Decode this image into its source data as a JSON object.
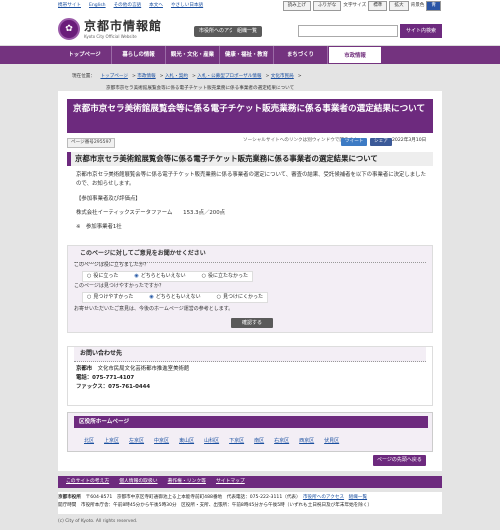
{
  "top": {
    "links": [
      "携帯サイト",
      "English",
      "その他の言語",
      "本文へ",
      "やさしい日本語"
    ],
    "read": "読み上げ",
    "ruby": "ふりがな",
    "size": "文字サイズ",
    "std": "標準",
    "big": "拡大",
    "color": "背景色",
    "blue": "青"
  },
  "site": {
    "name": "京都市情報館",
    "sub": "Kyoto City Official Website",
    "access": "市役所へのアクセス",
    "org": "組織一覧",
    "search_btn": "サイト内検索"
  },
  "nav": [
    "トップページ",
    "暮らしの情報",
    "観光・文化・産業",
    "健康・福祉・教育",
    "まちづくり",
    "市政情報"
  ],
  "crumb": {
    "label": "現在位置：",
    "items": [
      "トップページ",
      "市政情報",
      "入札・契約",
      "入札・公募型プロポーザル情報",
      "文化市民局"
    ],
    "last": "京都市京セラ美術館展覧会等に係る電子チケット販売業務に係る事業者の選定結果について"
  },
  "page": {
    "title": "京都市京セラ美術館展覧会等に係る電子チケット販売業務に係る事業者の選定結果について",
    "id": "ページ番号295597",
    "social": "ソーシャルサイトへのリンクは別ウィンドウで開きます",
    "tweet": "ツイート",
    "share": "シェア",
    "date": "2022年3月10日",
    "h2": "京都市京セラ美術館展覧会等に係る電子チケット販売業務に係る事業者の選定結果について",
    "p1": "京都市京セラ美術館展覧会等に係る電子チケット販売業務に係る事業者の選定について、審査の結果、受託候補者を以下の事業者に決定しましたので、お知らせします。",
    "eval": "【参加事業者及び評価点】",
    "company": "株式会社イーティックスデータファーム　　153.3点／200点",
    "note": "※　参加事業者1社"
  },
  "feedback": {
    "head": "このページに対してご意見をお聞かせください",
    "q1": "このページは役に立ちましたか？",
    "q1o": [
      "役に立った",
      "どちらともいえない",
      "役に立たなかった"
    ],
    "q2": "このページは見つけやすかったですか？",
    "q2o": [
      "見つけやすかった",
      "どちらともいえない",
      "見つけにくかった"
    ],
    "msg": "お寄せいただいたご意見は、今後のホームページ運営の参考とします。",
    "submit": "確認する"
  },
  "contact": {
    "head": "お問い合わせ先",
    "org": "京都市",
    "dept": "文化市民局文化芸術都市推進室美術館",
    "tel": "電話：075-771-4107",
    "fax": "ファックス：075-761-0444"
  },
  "ward": {
    "head": "区役所ホームページ",
    "items": [
      "北区",
      "上京区",
      "左京区",
      "中京区",
      "東山区",
      "山科区",
      "下京区",
      "南区",
      "右京区",
      "西京区",
      "伏見区"
    ]
  },
  "pagetop": "ページの先頭へ戻る",
  "footer": {
    "links": [
      "このサイトの考え方",
      "個人情報の取扱い",
      "著作権・リンク等",
      "サイトマップ"
    ],
    "city": "京都市役所",
    "addr": "〒604-8571　京都市中京区寺町通御池上る上本能寺前町488番地　代表電話：075-222-3111（代表）",
    "acc": "市役所へのアクセス",
    "orgl": "組織一覧",
    "hours": "開庁時間　市役所本庁舎：午前8時45分から午後5時30分　区役所・支所、出張所：午前8時45分から午後5時（いずれも土日祝日及び年末年始を除く）",
    "copy": "(c) City of Kyoto. All rights reserved."
  }
}
